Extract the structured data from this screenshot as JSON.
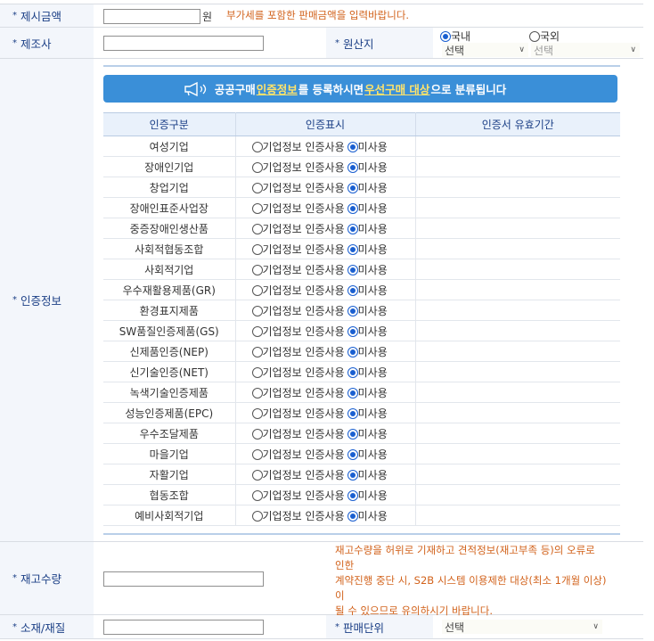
{
  "price": {
    "label": "제시금액",
    "value": "",
    "unit": "원",
    "note": "부가세를 포함한 판매금액을 입력바랍니다."
  },
  "maker": {
    "label": "제조사",
    "value": ""
  },
  "origin": {
    "label": "원산지",
    "domestic_label": "국내",
    "foreign_label": "국외",
    "domestic_selected": true,
    "domestic_select": "선택",
    "foreign_select": "선택"
  },
  "cert": {
    "label": "인증정보",
    "banner": {
      "text1": "공공구매 ",
      "highlight1": "인증정보",
      "text2": "를 등록하시면 ",
      "highlight2": "우선구매 대상",
      "text3": "으로 분류됩니다"
    },
    "headers": [
      "인증구분",
      "인증표시",
      "인증서 유효기간"
    ],
    "option_use": "기업정보 인증사용",
    "option_none": "미사용",
    "rows": [
      {
        "name": "여성기업",
        "selected": "none",
        "validity": ""
      },
      {
        "name": "장애인기업",
        "selected": "none",
        "validity": ""
      },
      {
        "name": "창업기업",
        "selected": "none",
        "validity": ""
      },
      {
        "name": "장애인표준사업장",
        "selected": "none",
        "validity": ""
      },
      {
        "name": "중증장애인생산품",
        "selected": "none",
        "validity": ""
      },
      {
        "name": "사회적협동조합",
        "selected": "none",
        "validity": ""
      },
      {
        "name": "사회적기업",
        "selected": "none",
        "validity": ""
      },
      {
        "name": "우수재활용제품(GR)",
        "selected": "none",
        "validity": ""
      },
      {
        "name": "환경표지제품",
        "selected": "none",
        "validity": ""
      },
      {
        "name": "SW품질인증제품(GS)",
        "selected": "none",
        "validity": ""
      },
      {
        "name": "신제품인증(NEP)",
        "selected": "none",
        "validity": ""
      },
      {
        "name": "신기술인증(NET)",
        "selected": "none",
        "validity": ""
      },
      {
        "name": "녹색기술인증제품",
        "selected": "none",
        "validity": ""
      },
      {
        "name": "성능인증제품(EPC)",
        "selected": "none",
        "validity": ""
      },
      {
        "name": "우수조달제품",
        "selected": "none",
        "validity": ""
      },
      {
        "name": "마을기업",
        "selected": "none",
        "validity": ""
      },
      {
        "name": "자활기업",
        "selected": "none",
        "validity": ""
      },
      {
        "name": "협동조합",
        "selected": "none",
        "validity": ""
      },
      {
        "name": "예비사회적기업",
        "selected": "none",
        "validity": ""
      }
    ]
  },
  "stock": {
    "label": "재고수량",
    "value": "",
    "note_lines": [
      "재고수량을 허위로 기재하고 견적정보(재고부족 등)의 오류로",
      "인한",
      "계약진행 중단 시, S2B 시스템 이용제한 대상(최소 1개월 이상)",
      "이",
      "될 수 있으므로 유의하시기 바랍니다."
    ]
  },
  "material": {
    "label": "소재/재질",
    "value": ""
  },
  "sales_unit": {
    "label": "판매단위",
    "select": "선택"
  },
  "colors": {
    "label_bg": "#f3f6fb",
    "label_text": "#1b3f86",
    "note": "#d2621b",
    "banner": "#3a8fd8",
    "radio_on": "#1a5fd0"
  }
}
